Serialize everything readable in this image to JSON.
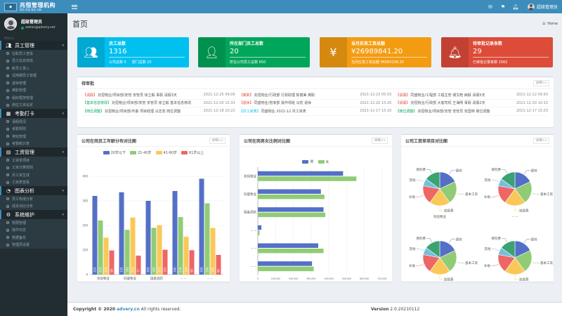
{
  "app": {
    "logo_title": "兆恒管理机构",
    "logo_sub": "德凯   质量   服务   创新"
  },
  "user": {
    "name": "超级管理员",
    "account": "admin@advery.net"
  },
  "menu_caption": "Menu",
  "menu": [
    {
      "label": "员工管理",
      "icon": "users-icon",
      "items": [
        "在职员工查看",
        "员工信息修改",
        "新员工录入",
        "试用期员工管理",
        "退休管理",
        "离职管理",
        "组织框架管理",
        "岗位工资设定"
      ]
    },
    {
      "label": "考勤打卡",
      "icon": "calendar-icon",
      "items": [
        "请假情况",
        "考勤规则",
        "排班管理",
        "考勤统计表"
      ]
    },
    {
      "label": "工资管理",
      "icon": "money-icon",
      "items": [
        "工资单项目",
        "工资计算规则",
        "月工资生成",
        "工资表查看"
      ]
    },
    {
      "label": "图表分析",
      "icon": "chart-icon",
      "items": [
        "员工构成分析",
        "成本对比分析"
      ]
    },
    {
      "label": "系统维护",
      "icon": "gear-icon",
      "items": [
        "权限管理",
        "操作日志",
        "数据备份",
        "管理员设置"
      ]
    }
  ],
  "topbar": {
    "user": "超级管理员",
    "icons": [
      "mail-icon",
      "flag-icon",
      "bell-icon"
    ]
  },
  "page": {
    "title": "首页",
    "crumb": "Home"
  },
  "stats": [
    {
      "label": "员工总数",
      "value": "1316",
      "foot": [
        "公司总数 5",
        "部门总数 25"
      ],
      "color": "#00c0ef",
      "icon": "users-icon"
    },
    {
      "label": "所在部门员工总数",
      "value": "20",
      "foot": [
        "所在公司员工总数 650"
      ],
      "color": "#00a65a",
      "icon": "user-icon"
    },
    {
      "label": "当月实发工资总额",
      "value": "¥26989841.20",
      "foot": [
        "当月应发工资总额 ¥6565236.25"
      ],
      "color": "#f39c12",
      "icon": "yen-icon"
    },
    {
      "label": "待审批记录条数",
      "value": "29",
      "foot": [
        "已审批记录条数 1562"
      ],
      "color": "#dd4b39",
      "icon": "bell-icon"
    }
  ],
  "todo": {
    "title": "待审批",
    "more": "详细>>",
    "rows": [
      [
        {
          "tag": "【请假】",
          "color": "#dd4b39",
          "text": "兆恒物业/项目部/安管 安管员 徐立毅 事假 请假3天",
          "date": "2021-12-25 09:06"
        },
        {
          "tag": "【基本信息修改】",
          "color": "#00a65a",
          "text": "兆恒物业/项目部/安管 安管员 徐立毅 基本信息修改",
          "date": "2021-12-20 15:33"
        },
        {
          "tag": "【岗位调整】",
          "color": "#00a65a",
          "text": "兆恒物业/项目部/市委 项目经理 马志发 岗位调整",
          "date": "2021-12-18 10:22"
        }
      ],
      [
        {
          "tag": "【离职】",
          "color": "#dd4b39",
          "text": "兆恒物业/行政部 行政助理 陈丽美 离职",
          "date": "2021-12-23 05:03"
        },
        {
          "tag": "【退休】",
          "color": "#dd4b39",
          "text": "同盛物业/管家部 操作领班 马宏 退休",
          "date": "2021-12-20 15:20"
        },
        {
          "tag": "【月工资表】",
          "color": "#00c0ef",
          "text": "同盛物业 2021-12 月工资表",
          "date": "2021-12-17 15:10"
        }
      ],
      [
        {
          "tag": "【请假】",
          "color": "#dd4b39",
          "text": "同盛物业/工程部 工程主管 谢文皓 病假 请假5天",
          "date": "2021-12-22 09:50"
        },
        {
          "tag": "【请假】",
          "color": "#dd4b39",
          "text": "兆恒物业/行政部 大客司机 王海明 事假 请假2天",
          "date": "2021-12-20 10:15"
        },
        {
          "tag": "【岗位调整】",
          "color": "#00a65a",
          "text": "兆恒物业/项目部/安管 安管员 张国林 岗位调整",
          "date": "2021-12-17 15:03"
        }
      ]
    ]
  },
  "panels": {
    "age": {
      "title": "公司在岗员工年龄分布对比图",
      "more": "详细>>"
    },
    "gender": {
      "title": "公司在岗男女比例对比图",
      "more": "详细>>"
    },
    "salary": {
      "title": "公司工资单项目对比图",
      "more": "详细>>"
    }
  },
  "chart_data": [
    {
      "type": "bar",
      "title": "公司在岗员工年龄分布对比图",
      "categories": [
        "兆恒物业",
        "同盛物业",
        "国金酒店",
        "-- --",
        "-- --"
      ],
      "series": [
        {
          "name": "20岁以下",
          "color": "#5470c6",
          "values": [
            320,
            335,
            300,
            340,
            390
          ]
        },
        {
          "name": "21-40岁",
          "color": "#91cc75",
          "values": [
            220,
            182,
            190,
            234,
            290
          ]
        },
        {
          "name": "41-60岁",
          "color": "#fac858",
          "values": [
            150,
            232,
            201,
            154,
            190
          ]
        },
        {
          "name": "61岁以上",
          "color": "#ee6666",
          "values": [
            98,
            77,
            101,
            99,
            80
          ]
        }
      ],
      "ylim": [
        0,
        400
      ],
      "yticks": [
        0,
        100,
        200,
        300,
        400
      ]
    },
    {
      "type": "bar",
      "orientation": "horizontal",
      "title": "公司在岗男女比例对比图",
      "categories": [
        "兆恒物业",
        "同盛物业",
        "国金酒店",
        "-- --",
        "-- --",
        "-- --"
      ],
      "series": [
        {
          "name": "男",
          "color": "#5470c6",
          "values": [
            480000,
            355000,
            370000,
            20000,
            340000,
            305000
          ]
        },
        {
          "name": "女",
          "color": "#91cc75",
          "values": [
            555000,
            375000,
            380000,
            10000,
            370000,
            315000
          ]
        }
      ],
      "xlim": [
        0,
        700000
      ],
      "xticks": [
        "0",
        "100,000",
        "200,000",
        "300,000",
        "400,000",
        "500,000",
        "600,000",
        "700,000"
      ]
    },
    {
      "type": "pie",
      "title": "公司工资单项目对比图",
      "slice_labels": [
        "绩效",
        "基本工资",
        "加班费",
        "补助",
        "其他",
        "保险费"
      ],
      "slice_colors": [
        "#5470c6",
        "#91cc75",
        "#fac858",
        "#ee6666",
        "#73c0de",
        "#3ba272"
      ],
      "pies": [
        {
          "name": "兆恒物业",
          "values": [
            18,
            22,
            20,
            18,
            7,
            15
          ]
        },
        {
          "name": "-- --",
          "values": [
            18,
            22,
            20,
            18,
            7,
            15
          ]
        },
        {
          "name": "国金酒店",
          "values": [
            18,
            22,
            20,
            18,
            7,
            15
          ]
        },
        {
          "name": "-- --",
          "values": [
            18,
            22,
            20,
            18,
            7,
            15
          ]
        }
      ]
    }
  ],
  "footer": {
    "copyright": "Copyright © 2020",
    "link": "advery.cn",
    "rights": "All rights reserved.",
    "version_label": "Version",
    "version": "2.0.20210112"
  }
}
